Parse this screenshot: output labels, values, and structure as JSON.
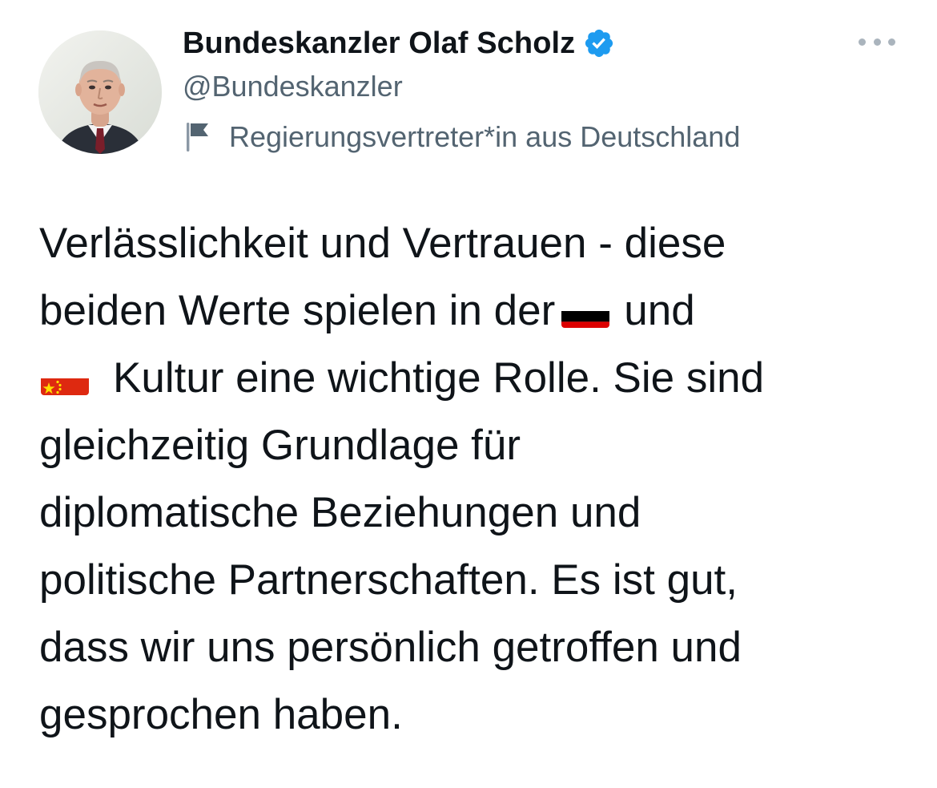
{
  "author": {
    "display_name": "Bundeskanzler Olaf Scholz",
    "handle": "@Bundeskanzler",
    "verified": true,
    "affiliation_label": "Regierungsvertreter*in aus Deutschland"
  },
  "colors": {
    "verified_badge": "#1d9bf0",
    "secondary_text": "#536471",
    "primary_text": "#0f1419"
  },
  "icons": {
    "verified": "verified-badge-icon",
    "affiliation": "flag-icon",
    "more": "more-horizontal-icon",
    "flag_germany": "germany-flag-emoji",
    "flag_china": "china-flag-emoji"
  },
  "tweet": {
    "lines": [
      "Verlässlichkeit und Vertrauen - diese",
      "beiden Werte spielen in der",
      "und",
      "Kultur eine wichtige Rolle. Sie sind",
      "gleichzeitig Grundlage für",
      "diplomatische Beziehungen und",
      "politische Partnerschaften. Es ist gut,",
      "dass wir uns persönlich getroffen und",
      "gesprochen haben."
    ]
  }
}
